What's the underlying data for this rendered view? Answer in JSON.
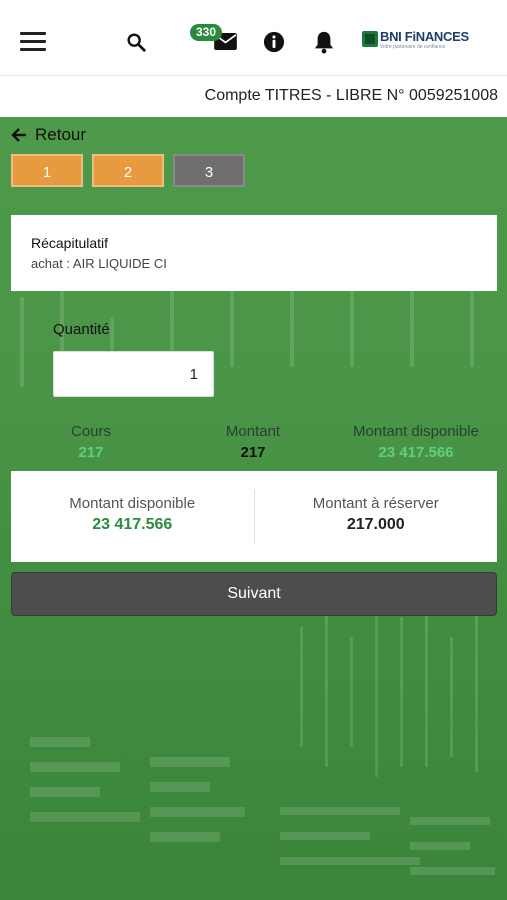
{
  "header": {
    "mail_badge": "330",
    "logo_text": "BNI FiNANCES",
    "logo_subtitle": "Votre partenaire de confiance"
  },
  "account": {
    "title": "Compte TITRES - LIBRE N° 0059251008"
  },
  "nav": {
    "back_label": "Retour"
  },
  "steps": [
    {
      "label": "1",
      "state": "done"
    },
    {
      "label": "2",
      "state": "done"
    },
    {
      "label": "3",
      "state": "current"
    }
  ],
  "recap": {
    "title": "Récapitulatif",
    "subtitle": "achat : AIR LIQUIDE CI"
  },
  "quantity": {
    "label": "Quantité",
    "value": "1"
  },
  "summary": {
    "cours_label": "Cours",
    "cours_value": "217",
    "montant_label": "Montant",
    "montant_value": "217",
    "disponible_label": "Montant disponible",
    "disponible_value": "23 417.566"
  },
  "amounts": {
    "available_label": "Montant disponible",
    "available_value": "23 417.566",
    "reserve_label": "Montant à réserver",
    "reserve_value": "217.000"
  },
  "actions": {
    "next_label": "Suivant"
  },
  "colors": {
    "brand_green": "#2b8a3e",
    "background_green": "#4a9547",
    "step_done": "#e79a3e",
    "step_current": "#6f6f6f",
    "button_dark": "#4d4d4d"
  }
}
